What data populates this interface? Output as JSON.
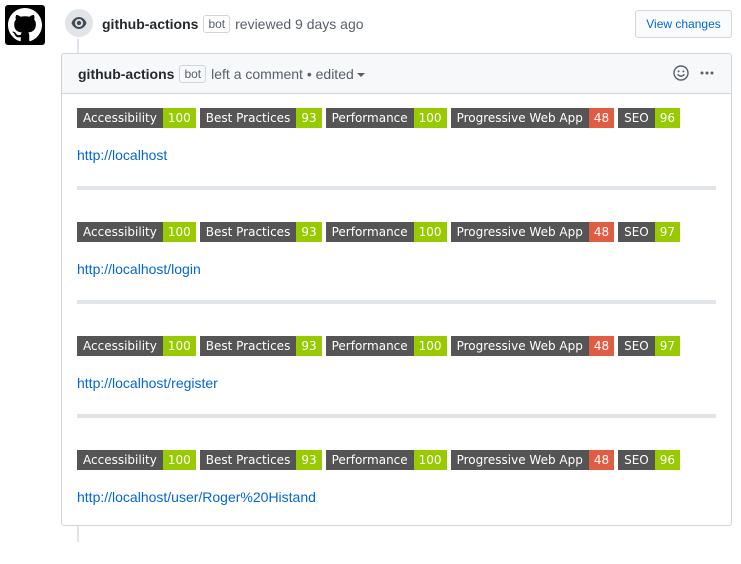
{
  "review": {
    "author": "github-actions",
    "bot_label": "bot",
    "action_text": "reviewed 9 days ago",
    "view_changes_label": "View changes"
  },
  "comment": {
    "author": "github-actions",
    "bot_label": "bot",
    "meta_text": "left a comment • edited"
  },
  "colors": {
    "pass": "#97ca00",
    "fail": "#e05d44",
    "label_bg": "#555555"
  },
  "reports": [
    {
      "url": "http://localhost",
      "scores": [
        {
          "label": "Accessibility",
          "value": "100",
          "status": "pass"
        },
        {
          "label": "Best Practices",
          "value": "93",
          "status": "pass"
        },
        {
          "label": "Performance",
          "value": "100",
          "status": "pass"
        },
        {
          "label": "Progressive Web App",
          "value": "48",
          "status": "fail"
        },
        {
          "label": "SEO",
          "value": "96",
          "status": "pass"
        }
      ]
    },
    {
      "url": "http://localhost/login",
      "scores": [
        {
          "label": "Accessibility",
          "value": "100",
          "status": "pass"
        },
        {
          "label": "Best Practices",
          "value": "93",
          "status": "pass"
        },
        {
          "label": "Performance",
          "value": "100",
          "status": "pass"
        },
        {
          "label": "Progressive Web App",
          "value": "48",
          "status": "fail"
        },
        {
          "label": "SEO",
          "value": "97",
          "status": "pass"
        }
      ]
    },
    {
      "url": "http://localhost/register",
      "scores": [
        {
          "label": "Accessibility",
          "value": "100",
          "status": "pass"
        },
        {
          "label": "Best Practices",
          "value": "93",
          "status": "pass"
        },
        {
          "label": "Performance",
          "value": "100",
          "status": "pass"
        },
        {
          "label": "Progressive Web App",
          "value": "48",
          "status": "fail"
        },
        {
          "label": "SEO",
          "value": "97",
          "status": "pass"
        }
      ]
    },
    {
      "url": "http://localhost/user/Roger%20Histand",
      "scores": [
        {
          "label": "Accessibility",
          "value": "100",
          "status": "pass"
        },
        {
          "label": "Best Practices",
          "value": "93",
          "status": "pass"
        },
        {
          "label": "Performance",
          "value": "100",
          "status": "pass"
        },
        {
          "label": "Progressive Web App",
          "value": "48",
          "status": "fail"
        },
        {
          "label": "SEO",
          "value": "96",
          "status": "pass"
        }
      ]
    }
  ]
}
